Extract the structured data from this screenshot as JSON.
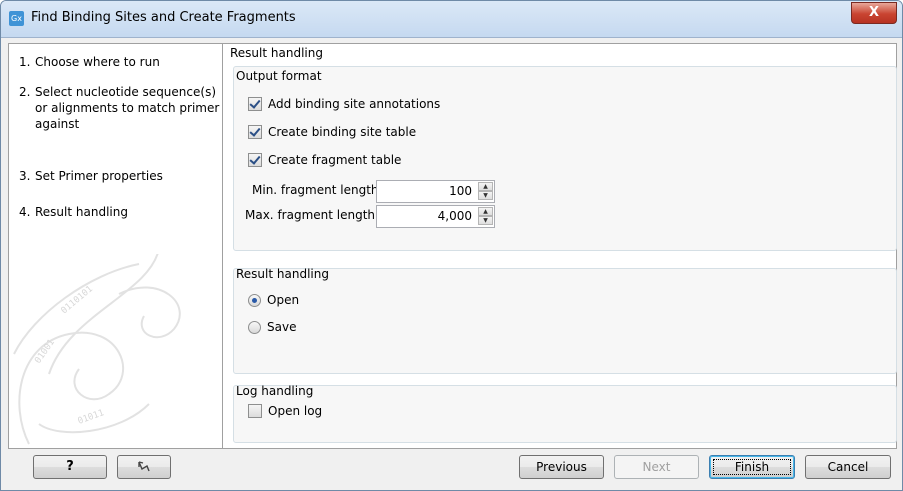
{
  "window": {
    "title": "Find Binding Sites and Create Fragments",
    "app_icon": "Gx",
    "close_glyph": "X"
  },
  "steps": [
    {
      "num": "1.",
      "label": "Choose where to run"
    },
    {
      "num": "2.",
      "label": "Select nucleotide sequence(s) or alignments to match primer against"
    },
    {
      "num": "3.",
      "label": "Set Primer properties"
    },
    {
      "num": "4.",
      "label": "Result handling"
    }
  ],
  "panel": {
    "heading": "Result handling",
    "output_format": {
      "label": "Output format",
      "add_annotations": {
        "label": "Add binding site annotations",
        "checked": true
      },
      "binding_table": {
        "label": "Create binding site table",
        "checked": true
      },
      "fragment_table": {
        "label": "Create fragment table",
        "checked": true
      },
      "min_length": {
        "label": "Min. fragment length",
        "value": "100"
      },
      "max_length": {
        "label": "Max. fragment length",
        "value": "4,000"
      }
    },
    "result_handling": {
      "label": "Result handling",
      "open": {
        "label": "Open",
        "selected": true
      },
      "save": {
        "label": "Save",
        "selected": false
      }
    },
    "log_handling": {
      "label": "Log handling",
      "open_log": {
        "label": "Open log",
        "checked": false
      }
    }
  },
  "footer": {
    "help_label": "?",
    "reset_icon": "undo-icon",
    "previous_label": "Previous",
    "next_label": "Next",
    "finish_label": "Finish",
    "cancel_label": "Cancel"
  }
}
